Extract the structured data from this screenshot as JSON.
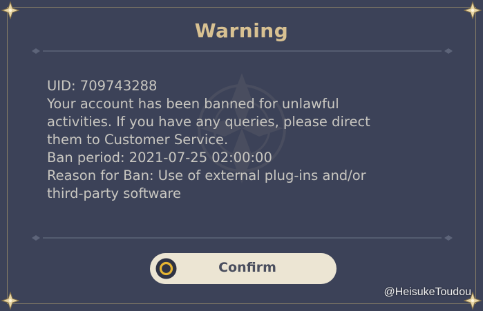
{
  "dialog": {
    "title": "Warning",
    "message_lines": [
      "UID: 709743288",
      "Your account has been banned for unlawful",
      "activities. If you have any queries, please direct",
      "them to Customer Service.",
      "Ban period: 2021-07-25 02:00:00",
      "Reason for Ban: Use of external plug-ins and/or",
      "third-party software"
    ],
    "confirm_label": "Confirm"
  },
  "credit": "@HeisukeToudou",
  "colors": {
    "panel": "#3c4258",
    "title": "#d8c192",
    "text": "#c9c7c1",
    "button_bg": "#ece5d3",
    "button_text": "#4a4e5e",
    "frame": "#8a8068"
  },
  "icons": [
    "corner-ornament-icon",
    "divider-ornament-icon",
    "confirm-circle-icon",
    "emblem-watermark-icon"
  ]
}
